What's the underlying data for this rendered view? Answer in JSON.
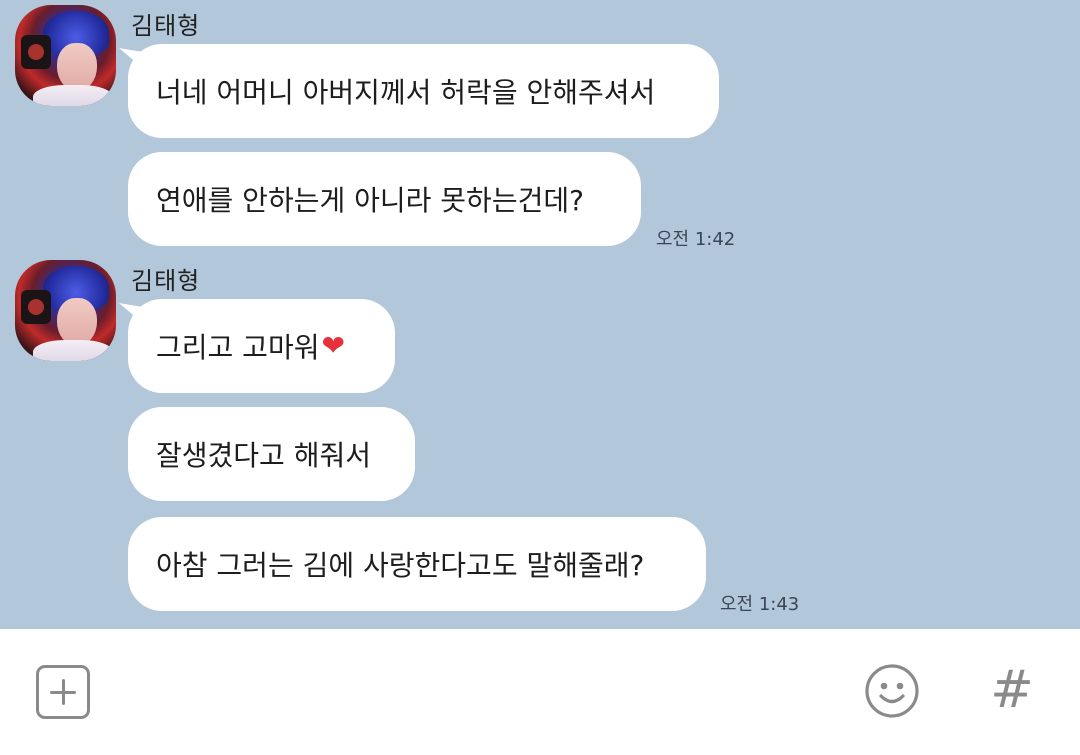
{
  "messages": [
    {
      "sender": "김태형",
      "bubbles": [
        "너네 어머니 아버지께서 허락을 안해주셔서",
        "연애를 안하는게 아니라 못하는건데?"
      ],
      "time": "오전 1:42"
    },
    {
      "sender": "김태형",
      "bubbles": [
        "그리고 고마워",
        "잘생겼다고 해줘서",
        "아참 그러는 김에 사랑한다고도 말해줄래?"
      ],
      "heart_emoji": "❤",
      "time": "오전 1:43"
    }
  ],
  "input_bar": {
    "plus_icon": "plus-square-icon",
    "emoji_icon": "smiley-icon",
    "hash_label": "#"
  },
  "colors": {
    "chat_background": "#b2c7da",
    "bubble": "#ffffff",
    "heart": "#e8303d",
    "icon_gray": "#8a8a8a"
  }
}
